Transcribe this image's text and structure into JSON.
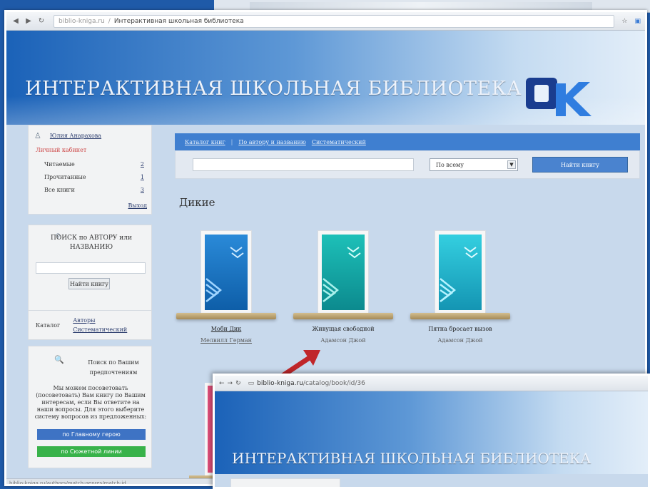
{
  "browser": {
    "host": "biblio-kniga.ru",
    "separator": "/",
    "tab_title": "Интерактивная школьная библиотека"
  },
  "site": {
    "banner_title": "ИНТЕРАКТИВНАЯ ШКОЛЬНАЯ БИБЛИОТЕКА",
    "logo_text": "ОК"
  },
  "user_panel": {
    "name": "Юлия Анарахова",
    "cabinet_label": "Личный кабинет",
    "stats": [
      {
        "label": "Читаемые",
        "value": "2"
      },
      {
        "label": "Прочитанные",
        "value": "1"
      },
      {
        "label": "Все книги",
        "value": "3"
      }
    ],
    "logout": "Выход"
  },
  "search_panel": {
    "title": "ПОИСК по АВТОРУ или НАЗВАНИЮ",
    "button": "Найти книгу"
  },
  "catalog_panel": {
    "label": "Каталог",
    "links": [
      "Авторы",
      "Систематический"
    ]
  },
  "prefs_panel": {
    "title": "Поиск по Вашим предпочтениям",
    "text": "Мы можем посоветовать (посоветовать) Вам книгу по Вашим интересам, если Вы ответите на наши вопросы. Для этого выберите систему вопросов из предложенных:",
    "button_blue": "по Главному герою",
    "button_green": "по Сюжетной линии"
  },
  "content": {
    "breadcrumbs": [
      "Каталог книг",
      "По автору и названию",
      "Систематический"
    ],
    "select_value": "По всему",
    "search_button": "Найти книгу",
    "section_title": "Дикие",
    "books": [
      {
        "title": "Моби Дик",
        "author": "Мелвилл Герман",
        "color": "#1b74c4"
      },
      {
        "title": "Живущая свободной",
        "author": "Адамсон Джой",
        "color": "#14a8a4"
      },
      {
        "title": "Пятна бросает вызов",
        "author": "Адамсон Джой",
        "color": "#19b3c9"
      }
    ]
  },
  "overlay": {
    "host": "biblio-kniga.ru",
    "path": "/catalog/book/id/36",
    "banner_title": "ИНТЕРАКТИВНАЯ ШКОЛЬНАЯ БИБЛИОТЕКА"
  },
  "statusbar": "biblio-kniga.ru/authors/match-genres/match-id"
}
